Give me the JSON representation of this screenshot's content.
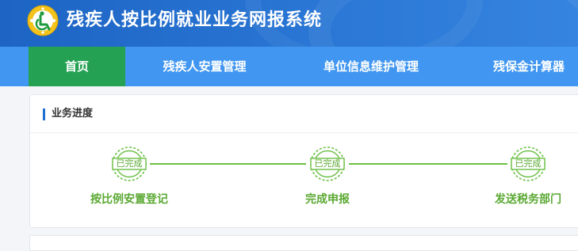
{
  "app": {
    "title": "残疾人按比例就业业务网报系统"
  },
  "nav": {
    "items": [
      {
        "label": "首页",
        "active": true
      },
      {
        "label": "残疾人安置管理",
        "active": false
      },
      {
        "label": "单位信息维护管理",
        "active": false
      },
      {
        "label": "残保金计算器",
        "active": false
      }
    ]
  },
  "progress": {
    "title": "业务进度",
    "steps": [
      {
        "status": "已完成",
        "label": "按比例安置登记"
      },
      {
        "status": "已完成",
        "label": "完成申报"
      },
      {
        "status": "已完成",
        "label": "发送税务部门"
      }
    ]
  },
  "colors": {
    "header": "#2b78d6",
    "navbar": "#4096f0",
    "active_tab": "#24a153",
    "complete": "#6bbf44"
  }
}
